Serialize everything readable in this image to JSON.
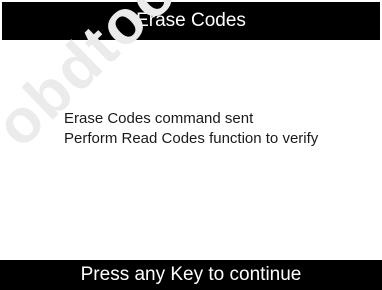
{
  "screen": {
    "title": "Erase Codes",
    "messages": [
      "Erase Codes command sent",
      "Perform Read Codes function to verify"
    ],
    "footer": "Press any Key to continue",
    "watermark": "obdtool"
  },
  "colors": {
    "bar_background": "#000000",
    "bar_text": "#ffffff",
    "body_background": "#ffffff",
    "body_text": "#1a1a1a",
    "watermark": "#ebebeb"
  }
}
